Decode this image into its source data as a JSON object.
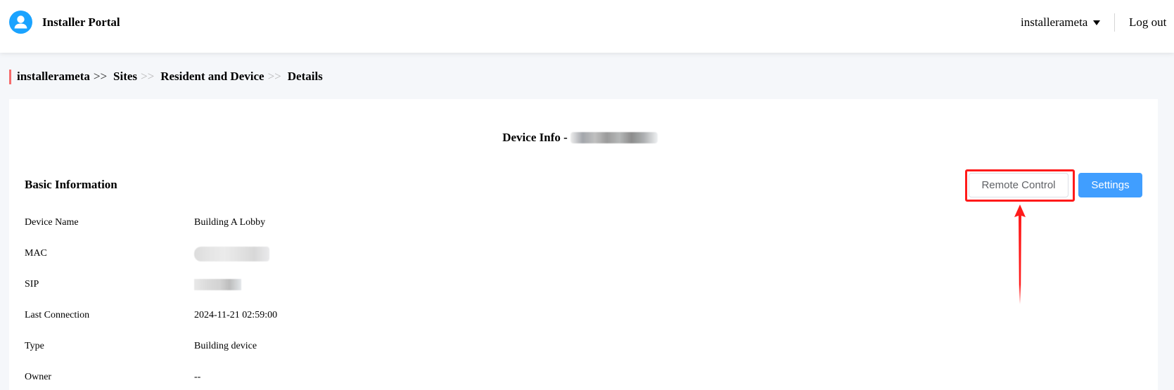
{
  "header": {
    "app_title": "Installer Portal",
    "brand_color": "#1aa3ff",
    "user_menu_label": "installerameta",
    "logout_label": "Log out"
  },
  "breadcrumb": {
    "items": [
      "installerameta",
      "Sites",
      "Resident and Device",
      "Details"
    ],
    "separator": ">>",
    "accent_color": "#f56c6c"
  },
  "device_info": {
    "title_prefix": "Device Info -",
    "title_id_redacted": true
  },
  "basic_information": {
    "section_title": "Basic Information",
    "rows": [
      {
        "label": "Device Name",
        "value": "Building A Lobby",
        "redacted": false
      },
      {
        "label": "MAC",
        "value": "",
        "redacted": true
      },
      {
        "label": "SIP",
        "value": "",
        "redacted": true
      },
      {
        "label": "Last Connection",
        "value": "2024-11-21 02:59:00",
        "redacted": false
      },
      {
        "label": "Type",
        "value": "Building device",
        "redacted": false
      },
      {
        "label": "Owner",
        "value": "--",
        "redacted": false
      }
    ]
  },
  "actions": {
    "remote_control_label": "Remote Control",
    "settings_label": "Settings",
    "primary_color": "#409eff",
    "highlight_color": "#ff1a1a"
  }
}
